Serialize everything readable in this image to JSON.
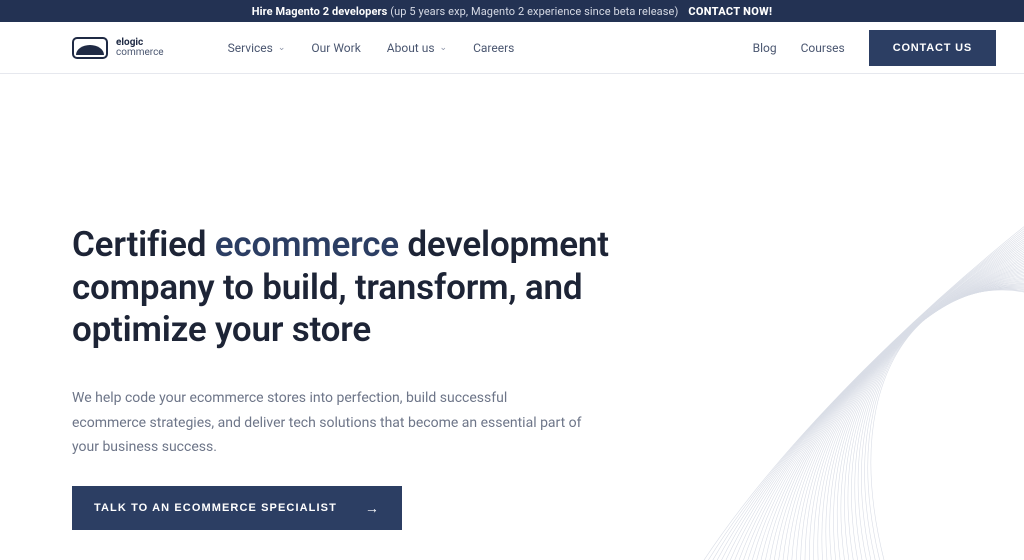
{
  "announce": {
    "lead": "Hire Magento 2 developers",
    "sub": "(up 5 years exp, Magento 2 experience since beta release)",
    "cta": "CONTACT NOW!"
  },
  "logo": {
    "line1": "elogic",
    "line2": "commerce"
  },
  "nav": {
    "primary": [
      {
        "label": "Services",
        "dropdown": true
      },
      {
        "label": "Our Work",
        "dropdown": false
      },
      {
        "label": "About us",
        "dropdown": true
      },
      {
        "label": "Careers",
        "dropdown": false
      }
    ],
    "secondary": [
      {
        "label": "Blog"
      },
      {
        "label": "Courses"
      }
    ],
    "contact_label": "CONTACT US"
  },
  "hero": {
    "title_pre": "Certified ",
    "title_accent": "ecommerce",
    "title_post": " development company to build, transform, and optimize your store",
    "subtitle": "We help code your ecommerce stores into perfection, build successful ecommerce strategies, and deliver tech solutions that become an essential part of your business success.",
    "cta_label": "TALK TO AN ECOMMERCE SPECIALIST"
  }
}
